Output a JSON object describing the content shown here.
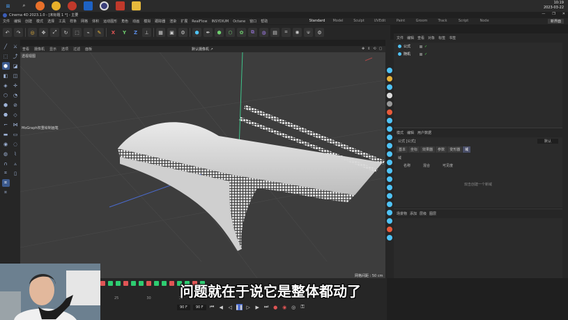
{
  "taskbar": {
    "icons": [
      "windows-start-icon",
      "search-icon",
      "firefox-icon",
      "chrome-icon",
      "chrome-alt-icon",
      "onedrive-icon",
      "cinema4d-icon",
      "app-red-icon",
      "file-explorer-icon"
    ],
    "time": "10:19",
    "date": "2023-03-22"
  },
  "window": {
    "title": "Cinema 4D 2023.1.0 - [未标题 1 *] - 主要",
    "doc_tab": "未标题 1 *"
  },
  "menu": {
    "items": [
      "文件",
      "编辑",
      "创建",
      "模式",
      "选择",
      "工具",
      "样条",
      "网格",
      "体积",
      "运动图形",
      "角色",
      "动画",
      "模拟",
      "跟踪器",
      "渲染",
      "扩展",
      "RealFlow",
      "INSYDIUM",
      "Octane",
      "窗口",
      "帮助"
    ]
  },
  "layouts": {
    "items": [
      "Standard",
      "Model",
      "Sculpt",
      "UVEdit",
      "Paint",
      "Groom",
      "Track",
      "Script",
      "Node"
    ],
    "active": "Standard",
    "new_scene": "新界面"
  },
  "viewport": {
    "menu": [
      "查看",
      "摄像机",
      "显示",
      "选项",
      "过滤",
      "面板"
    ],
    "name": "透视视图",
    "camera": "默认摄像机 ↗",
    "object_label": "MoGraph权重绘制画笔",
    "grid_spacing": "网格间距 : 50 cm"
  },
  "object_manager": {
    "menu": [
      "文件",
      "编辑",
      "查看",
      "对象",
      "标签",
      "书签"
    ],
    "objects": [
      {
        "name": "公式",
        "color": "#4fc3f7"
      },
      {
        "name": "随机",
        "color": "#4fc3f7"
      }
    ]
  },
  "attribute_manager": {
    "menu": [
      "模式",
      "编辑",
      "用户数据"
    ],
    "object_title": "公式 [公式]",
    "mode_value": "默认",
    "tabs": [
      "基本",
      "坐标",
      "效果器",
      "参数",
      "变形器",
      "域"
    ],
    "active_tab": "域",
    "section": "域",
    "columns": [
      "名称",
      "混合",
      "可见度"
    ],
    "empty_hint": "双击创建一个新域"
  },
  "layer_panel": {
    "items": [
      "场景物",
      "添加",
      "层级",
      "图层"
    ]
  },
  "timeline": {
    "frame_start": "90 F",
    "frame_end": "90 F",
    "ticks": [
      "25",
      "30",
      "35"
    ]
  },
  "subtitle": "问题就在于说它是整体都动了",
  "colors": {
    "accent": "#3d5b8f",
    "active_tab": "#4a4f69",
    "check": "#52d852",
    "keyframe": "#2ecc71"
  }
}
